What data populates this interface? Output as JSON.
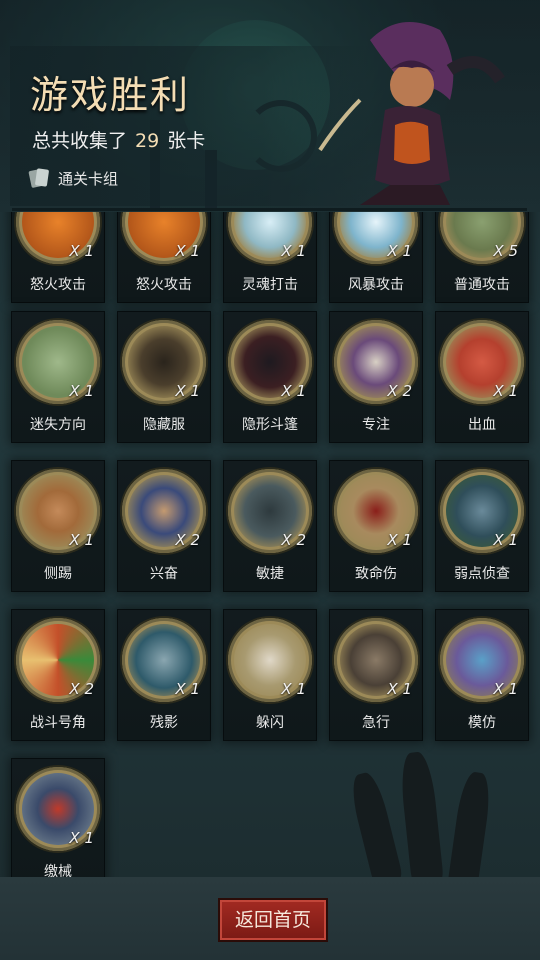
{
  "header": {
    "title": "游戏胜利",
    "collected_prefix": "总共收集了",
    "collected_count": "29",
    "collected_suffix": "张卡",
    "deck_label": "通关卡组"
  },
  "cards": [
    {
      "name": "怒火攻击",
      "count": "X 1",
      "icon": "flame-face-icon",
      "color": "#d06a1a"
    },
    {
      "name": "怒火攻击",
      "count": "X 1",
      "icon": "flame-face-icon",
      "color": "#d06a1a"
    },
    {
      "name": "灵魂打击",
      "count": "X 1",
      "icon": "ice-shard-icon",
      "color": "#7ab4c8"
    },
    {
      "name": "风暴攻击",
      "count": "X 1",
      "icon": "lightning-icon",
      "color": "#6aa6c8"
    },
    {
      "name": "普通攻击",
      "count": "X 5",
      "icon": "slash-icon",
      "color": "#5f8a5a"
    },
    {
      "name": "迷失方向",
      "count": "X 1",
      "icon": "signpost-icon",
      "color": "#6f8a5a"
    },
    {
      "name": "隐藏服",
      "count": "X 1",
      "icon": "hooded-cloak-icon",
      "color": "#3a3226"
    },
    {
      "name": "隐形斗篷",
      "count": "X 1",
      "icon": "cape-icon",
      "color": "#3b1f22"
    },
    {
      "name": "专注",
      "count": "X 2",
      "icon": "wizard-icon",
      "color": "#5a3a6a"
    },
    {
      "name": "出血",
      "count": "X 1",
      "icon": "octopus-icon",
      "color": "#b5402e"
    },
    {
      "name": "侧踢",
      "count": "X 1",
      "icon": "kick-icon",
      "color": "#a26a3a"
    },
    {
      "name": "兴奋",
      "count": "X 2",
      "icon": "excited-dwarf-icon",
      "color": "#3a4a7a"
    },
    {
      "name": "敏捷",
      "count": "X 2",
      "icon": "panther-icon",
      "color": "#2e3a3e"
    },
    {
      "name": "致命伤",
      "count": "X 1",
      "icon": "bleeding-wound-icon",
      "color": "#8a1e1a"
    },
    {
      "name": "弱点侦查",
      "count": "X 1",
      "icon": "wolf-head-icon",
      "color": "#2f4e5a"
    },
    {
      "name": "战斗号角",
      "count": "X 2",
      "icon": "war-horn-icon",
      "color": "#c4502a"
    },
    {
      "name": "残影",
      "count": "X 1",
      "icon": "shadow-figures-icon",
      "color": "#2e5a6a"
    },
    {
      "name": "躲闪",
      "count": "X 1",
      "icon": "dodge-icon",
      "color": "#6a3a2a"
    },
    {
      "name": "急行",
      "count": "X 1",
      "icon": "dash-icon",
      "color": "#4a4036"
    },
    {
      "name": "模仿",
      "count": "X 1",
      "icon": "goblin-mask-icon",
      "color": "#6a5a9a"
    },
    {
      "name": "缴械",
      "count": "X 1",
      "icon": "broken-shield-icon",
      "color": "#3a4a6a"
    }
  ],
  "footer": {
    "home_label": "返回首页"
  }
}
